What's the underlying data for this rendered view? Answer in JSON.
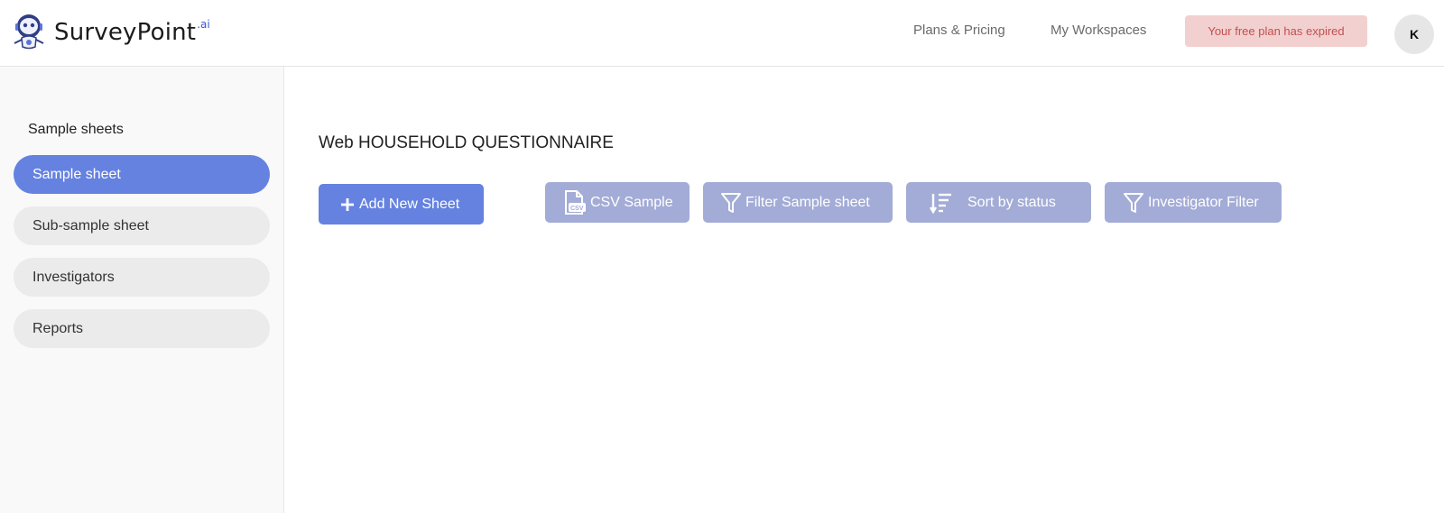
{
  "header": {
    "brand_name": "SurveyPoint",
    "brand_suffix": ".ai",
    "nav": [
      {
        "label": "Plans & Pricing"
      },
      {
        "label": "My Workspaces"
      }
    ],
    "plan_status": "Your free plan has expired",
    "avatar_initial": "K"
  },
  "sidebar": {
    "heading": "Sample sheets",
    "items": [
      {
        "label": "Sample sheet",
        "active": true
      },
      {
        "label": "Sub-sample sheet",
        "active": false
      },
      {
        "label": "Investigators",
        "active": false
      },
      {
        "label": "Reports",
        "active": false
      }
    ]
  },
  "main": {
    "title": "Web HOUSEHOLD QUESTIONNAIRE",
    "buttons": {
      "add_new": "Add New Sheet",
      "csv_sample": "CSV Sample",
      "filter_sample": "Filter Sample sheet",
      "sort_status": "Sort by status",
      "investigator_filter": "Investigator Filter"
    }
  },
  "colors": {
    "accent": "#6582e0",
    "muted_button": "#a3acd6",
    "expired_bg": "#f2d0d0",
    "expired_text": "#c34f4f"
  },
  "icons": [
    "mascot-logo-icon",
    "plus-icon",
    "csv-file-icon",
    "filter-icon",
    "sort-lines-icon"
  ]
}
